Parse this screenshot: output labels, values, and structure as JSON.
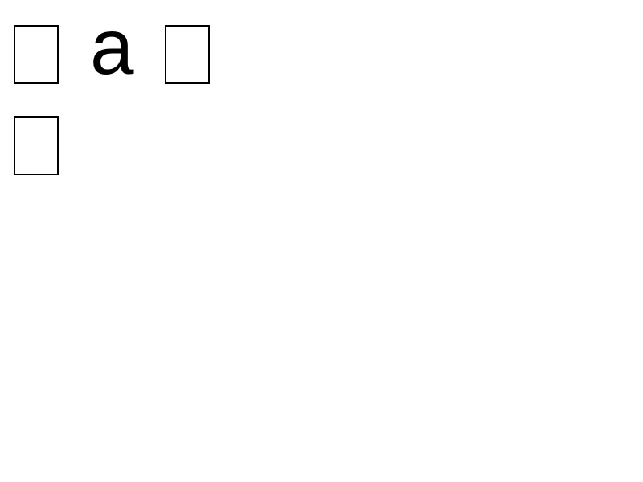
{
  "text": {
    "line1_letter": "a"
  },
  "glyphs": {
    "placeholder_name": "missing-glyph-box",
    "count_line1": 2,
    "count_line2": 1
  },
  "colors": {
    "background": "#ffffff",
    "text": "#000000"
  }
}
